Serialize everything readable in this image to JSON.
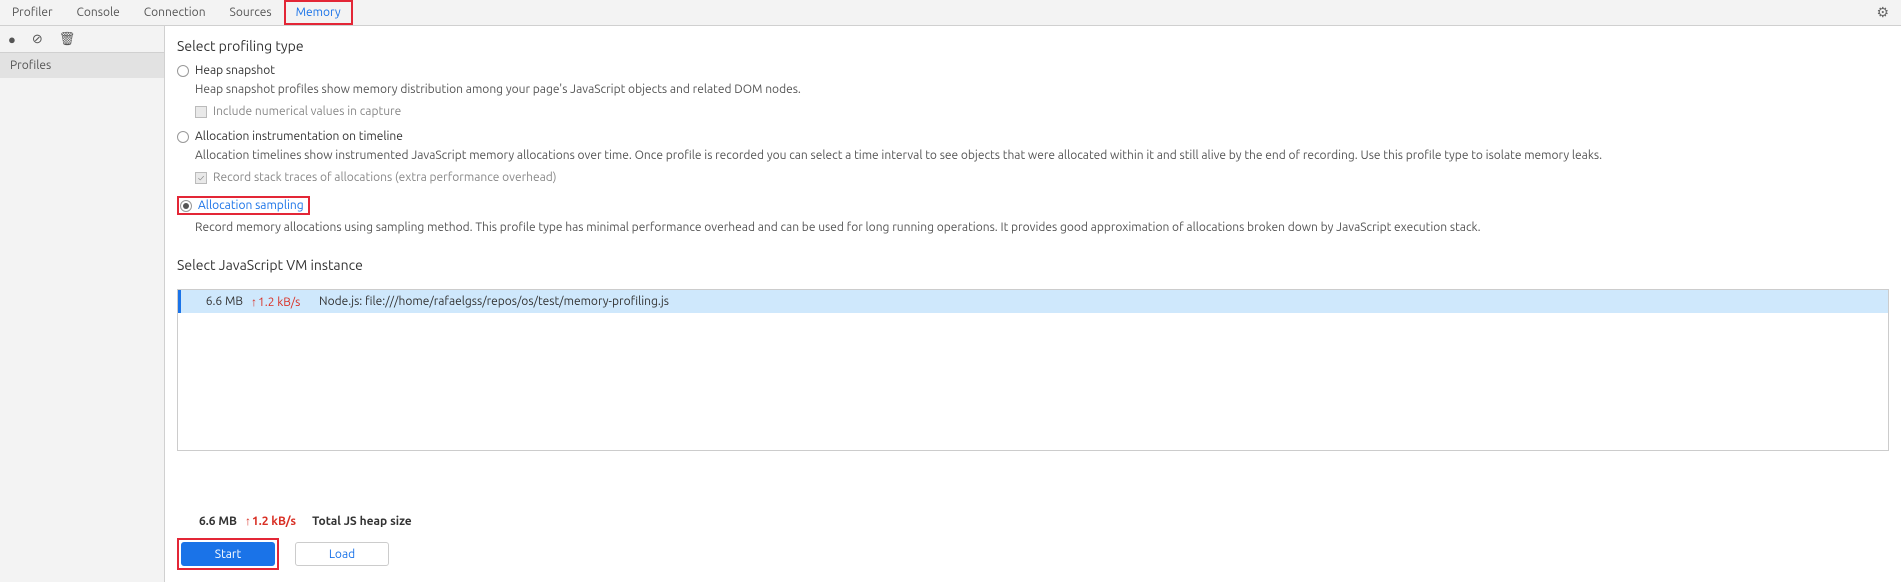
{
  "tabs": [
    "Profiler",
    "Console",
    "Connection",
    "Sources",
    "Memory"
  ],
  "activeTabIndex": 4,
  "sidebar": {
    "items": [
      "Profiles"
    ]
  },
  "profiling": {
    "title": "Select profiling type",
    "selectedIndex": 2,
    "options": [
      {
        "label": "Heap snapshot",
        "desc": "Heap snapshot profiles show memory distribution among your page's JavaScript objects and related DOM nodes.",
        "sub": {
          "label": "Include numerical values in capture",
          "checked": false
        }
      },
      {
        "label": "Allocation instrumentation on timeline",
        "desc": "Allocation timelines show instrumented JavaScript memory allocations over time. Once profile is recorded you can select a time interval to see objects that were allocated within it and still alive by the end of recording. Use this profile type to isolate memory leaks.",
        "sub": {
          "label": "Record stack traces of allocations (extra performance overhead)",
          "checked": true
        }
      },
      {
        "label": "Allocation sampling",
        "desc": "Record memory allocations using sampling method. This profile type has minimal performance overhead and can be used for long running operations. It provides good approximation of allocations broken down by JavaScript execution stack."
      }
    ]
  },
  "vm": {
    "title": "Select JavaScript VM instance",
    "instances": [
      {
        "size": "6.6 MB",
        "rate": "1.2 kB/s",
        "name": "Node.js: file:///home/rafaelgss/repos/os/test/memory-profiling.js"
      }
    ]
  },
  "footer": {
    "size": "6.6 MB",
    "rate": "1.2 kB/s",
    "label": "Total JS heap size",
    "start": "Start",
    "load": "Load"
  }
}
